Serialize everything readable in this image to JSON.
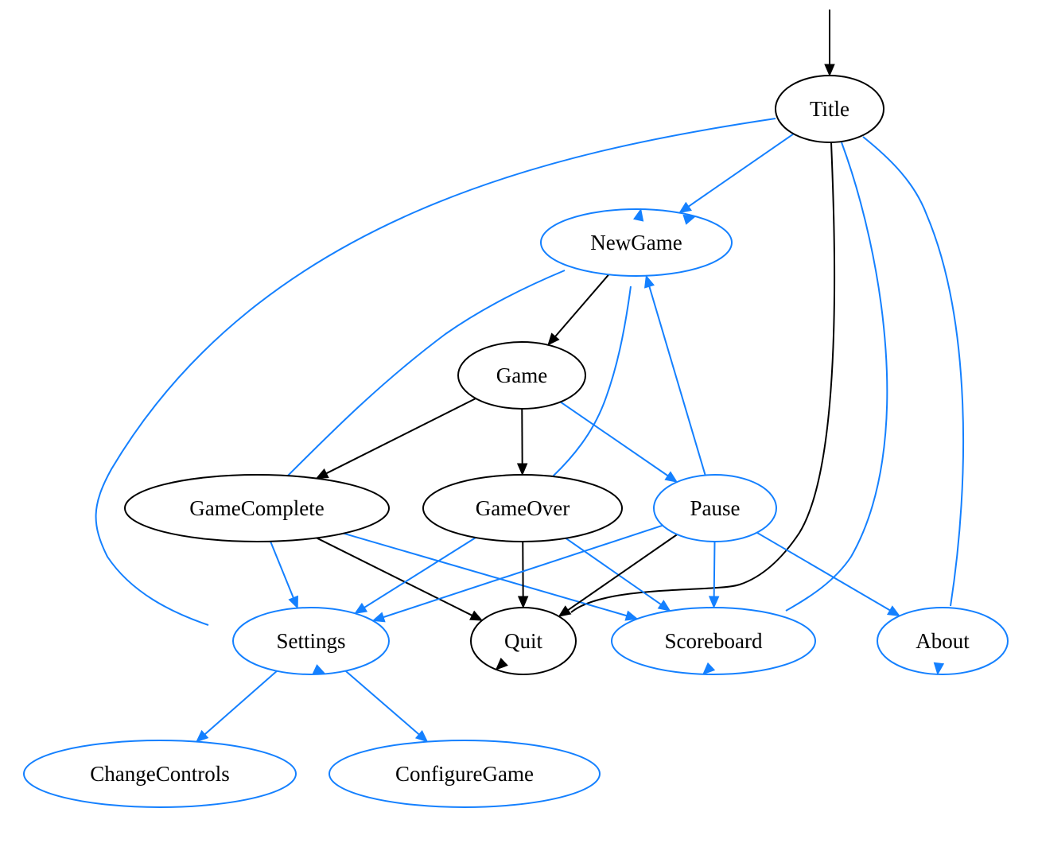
{
  "colors": {
    "default": "#000000",
    "highlight": "#1480ff"
  },
  "start_target": "Title",
  "nodes": [
    {
      "id": "Title",
      "label": "Title",
      "color": "default"
    },
    {
      "id": "NewGame",
      "label": "NewGame",
      "color": "highlight"
    },
    {
      "id": "Game",
      "label": "Game",
      "color": "default"
    },
    {
      "id": "GameComplete",
      "label": "GameComplete",
      "color": "default"
    },
    {
      "id": "GameOver",
      "label": "GameOver",
      "color": "default"
    },
    {
      "id": "Pause",
      "label": "Pause",
      "color": "highlight"
    },
    {
      "id": "Settings",
      "label": "Settings",
      "color": "highlight"
    },
    {
      "id": "Quit",
      "label": "Quit",
      "color": "default"
    },
    {
      "id": "Scoreboard",
      "label": "Scoreboard",
      "color": "highlight"
    },
    {
      "id": "About",
      "label": "About",
      "color": "highlight"
    },
    {
      "id": "ChangeControls",
      "label": "ChangeControls",
      "color": "highlight"
    },
    {
      "id": "ConfigureGame",
      "label": "ConfigureGame",
      "color": "highlight"
    }
  ],
  "edges": [
    {
      "from": "Title",
      "to": "NewGame",
      "color": "highlight"
    },
    {
      "from": "Title",
      "to": "Settings",
      "color": "highlight"
    },
    {
      "from": "Title",
      "to": "Quit",
      "color": "default"
    },
    {
      "from": "Title",
      "to": "Scoreboard",
      "color": "highlight"
    },
    {
      "from": "Title",
      "to": "About",
      "color": "highlight"
    },
    {
      "from": "NewGame",
      "to": "Game",
      "color": "default"
    },
    {
      "from": "Game",
      "to": "GameComplete",
      "color": "default"
    },
    {
      "from": "Game",
      "to": "GameOver",
      "color": "default"
    },
    {
      "from": "Game",
      "to": "Pause",
      "color": "highlight"
    },
    {
      "from": "GameComplete",
      "to": "NewGame",
      "color": "highlight"
    },
    {
      "from": "GameComplete",
      "to": "Settings",
      "color": "highlight"
    },
    {
      "from": "GameComplete",
      "to": "Quit",
      "color": "default"
    },
    {
      "from": "GameComplete",
      "to": "Scoreboard",
      "color": "highlight"
    },
    {
      "from": "GameOver",
      "to": "NewGame",
      "color": "highlight"
    },
    {
      "from": "GameOver",
      "to": "Settings",
      "color": "highlight"
    },
    {
      "from": "GameOver",
      "to": "Quit",
      "color": "default"
    },
    {
      "from": "GameOver",
      "to": "Scoreboard",
      "color": "highlight"
    },
    {
      "from": "Pause",
      "to": "NewGame",
      "color": "highlight"
    },
    {
      "from": "Pause",
      "to": "Settings",
      "color": "highlight"
    },
    {
      "from": "Pause",
      "to": "Quit",
      "color": "default"
    },
    {
      "from": "Pause",
      "to": "Scoreboard",
      "color": "highlight"
    },
    {
      "from": "Pause",
      "to": "About",
      "color": "highlight"
    },
    {
      "from": "Settings",
      "to": "ChangeControls",
      "color": "highlight"
    },
    {
      "from": "Settings",
      "to": "ConfigureGame",
      "color": "highlight"
    }
  ]
}
